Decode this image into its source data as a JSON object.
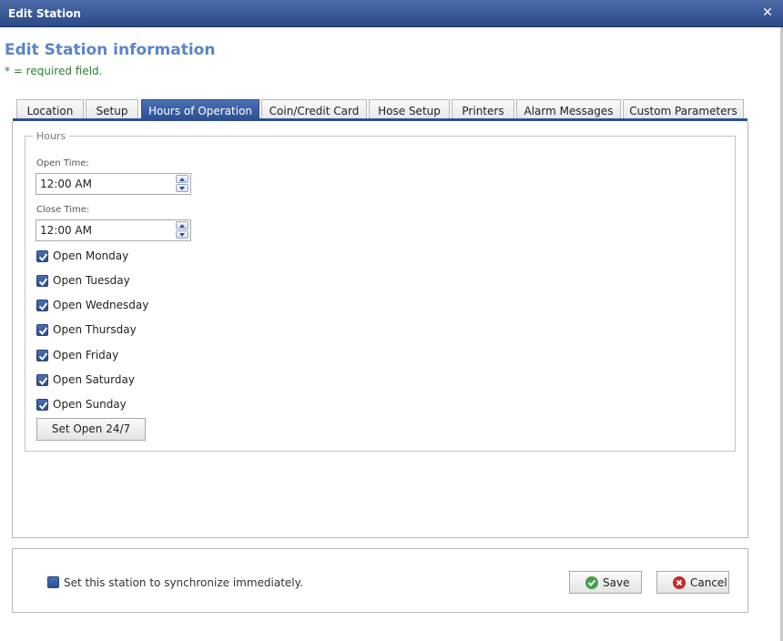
{
  "window": {
    "title": "Edit Station",
    "close_icon": "close-icon"
  },
  "heading": "Edit Station information",
  "required_note": "* = required field.",
  "tabs": [
    {
      "label": "Location"
    },
    {
      "label": "Setup"
    },
    {
      "label": "Hours of Operation",
      "active": true
    },
    {
      "label": "Coin/Credit Card"
    },
    {
      "label": "Hose Setup"
    },
    {
      "label": "Printers"
    },
    {
      "label": "Alarm Messages"
    },
    {
      "label": "Custom Parameters"
    }
  ],
  "hours": {
    "legend": "Hours",
    "open_time_label": "Open Time:",
    "open_time_value": "12:00 AM",
    "close_time_label": "Close Time:",
    "close_time_value": "12:00 AM",
    "days": [
      {
        "label": "Open Monday",
        "checked": true
      },
      {
        "label": "Open Tuesday",
        "checked": true
      },
      {
        "label": "Open Wednesday",
        "checked": true
      },
      {
        "label": "Open Thursday",
        "checked": true
      },
      {
        "label": "Open Friday",
        "checked": true
      },
      {
        "label": "Open Saturday",
        "checked": true
      },
      {
        "label": "Open Sunday",
        "checked": true
      }
    ],
    "set_open_button": "Set Open 24/7"
  },
  "footer": {
    "sync_label": "Set this station to synchronize immediately.",
    "sync_checked": false,
    "save_label": "Save",
    "cancel_label": "Cancel"
  },
  "colors": {
    "accent": "#2d4f93",
    "heading": "#5a84c8",
    "required": "#2f7d2f"
  }
}
